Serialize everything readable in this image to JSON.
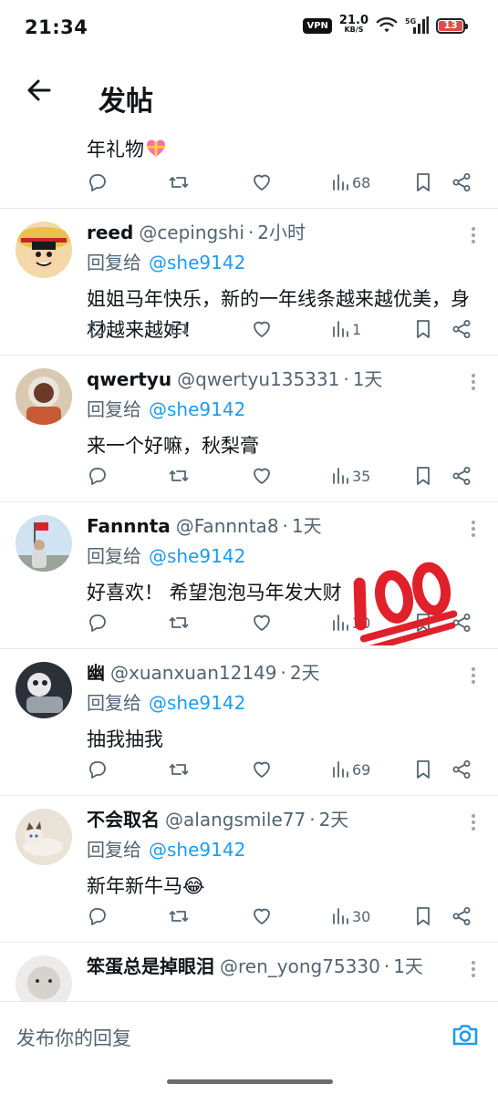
{
  "status": {
    "time": "21:34",
    "vpn": "VPN",
    "speed_value": "21.0",
    "speed_unit": "KB/S",
    "network": "5G",
    "battery_level": "13"
  },
  "header": {
    "title": "发帖"
  },
  "partial": {
    "text": "年礼物",
    "views": "68"
  },
  "replies": [
    {
      "name": "reed",
      "handle": "@cepingshi",
      "time": "2小时",
      "reply_label": "回复给",
      "reply_to": "@she9142",
      "text": "姐姐马年快乐，新的一年线条越来越优美，身材越来越好！",
      "views": "1"
    },
    {
      "name": "qwertyu",
      "handle": "@qwertyu135331",
      "time": "1天",
      "reply_label": "回复给",
      "reply_to": "@she9142",
      "text": "来一个好嘛，秋梨膏",
      "views": "35"
    },
    {
      "name": "Fannnta",
      "handle": "@Fannnta8",
      "time": "1天",
      "reply_label": "回复给",
      "reply_to": "@she9142",
      "text": "好喜欢！ 希望泡泡马年发大财",
      "views": "30"
    },
    {
      "name": "幽",
      "handle": "@xuanxuan12149",
      "time": "2天",
      "reply_label": "回复给",
      "reply_to": "@she9142",
      "text": "抽我抽我",
      "views": "69"
    },
    {
      "name": "不会取名",
      "handle": "@alangsmile77",
      "time": "2天",
      "reply_label": "回复给",
      "reply_to": "@she9142",
      "text": "新年新牛马😂",
      "views": "30"
    },
    {
      "name": "笨蛋总是掉眼泪",
      "handle": "@ren_yong75330",
      "time": "1天",
      "reply_label": "",
      "reply_to": "",
      "text": "",
      "views": ""
    }
  ],
  "compose": {
    "placeholder": "发布你的回复"
  },
  "separator": "·",
  "icons": {
    "reply": "reply-icon",
    "retweet": "retweet-icon",
    "like": "heart-icon",
    "views": "views-icon",
    "bookmark": "bookmark-icon",
    "share": "share-icon",
    "camera": "camera-icon"
  },
  "colors": {
    "link": "#1d9bf0",
    "secondary": "#536471",
    "emoji100": "#e0202a"
  }
}
